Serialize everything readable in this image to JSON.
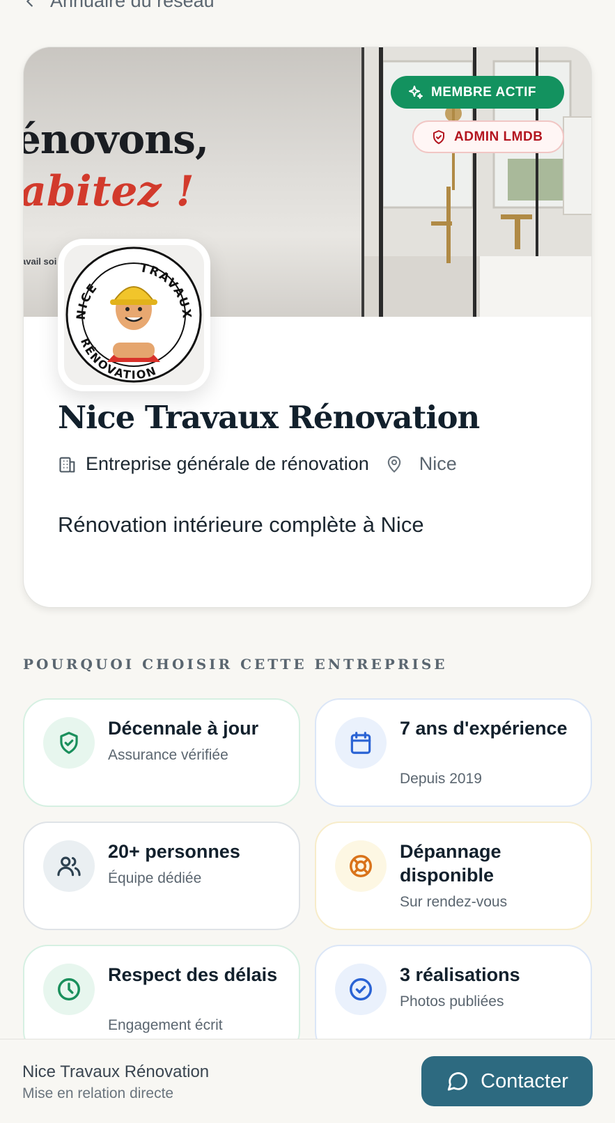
{
  "nav": {
    "back_label": "Annuaire du réseau"
  },
  "banner": {
    "headline_line1": "énovons,",
    "headline_line2": "abitez !",
    "small_text": "avail soi"
  },
  "badges": {
    "member": "MEMBRE ACTIF",
    "admin": "ADMIN LMDB"
  },
  "logo": {
    "ring_top": "NICE",
    "ring_right": "TRAVAUX",
    "ring_bottom": "RÉNOVATION"
  },
  "company": {
    "name": "Nice Travaux Rénovation",
    "category": "Entreprise générale de rénovation",
    "city": "Nice",
    "tagline": "Rénovation intérieure complète à Nice"
  },
  "section": {
    "title": "POURQUOI CHOISIR CETTE ENTREPRISE"
  },
  "features": [
    {
      "title": "Décennale à jour",
      "subtitle": "Assurance vérifiée",
      "icon": "shield-check-icon",
      "color": "#1a8f5c"
    },
    {
      "title": "7 ans d'expérience",
      "subtitle": "Depuis 2019",
      "icon": "calendar-icon",
      "color": "#2a63d4"
    },
    {
      "title": "20+ personnes",
      "subtitle": "Équipe dédiée",
      "icon": "users-icon",
      "color": "#2d4150"
    },
    {
      "title": "Dépannage disponible",
      "subtitle": "Sur rendez-vous",
      "icon": "lifebuoy-icon",
      "color": "#d9731a"
    },
    {
      "title": "Respect des délais",
      "subtitle": "Engagement écrit",
      "icon": "clock-icon",
      "color": "#1a8f5c"
    },
    {
      "title": "3 réalisations",
      "subtitle": "Photos publiées",
      "icon": "check-circle-icon",
      "color": "#2a63d4"
    }
  ],
  "bottom_bar": {
    "name": "Nice Travaux Rénovation",
    "subtitle": "Mise en relation directe",
    "contact_label": "Contacter"
  }
}
